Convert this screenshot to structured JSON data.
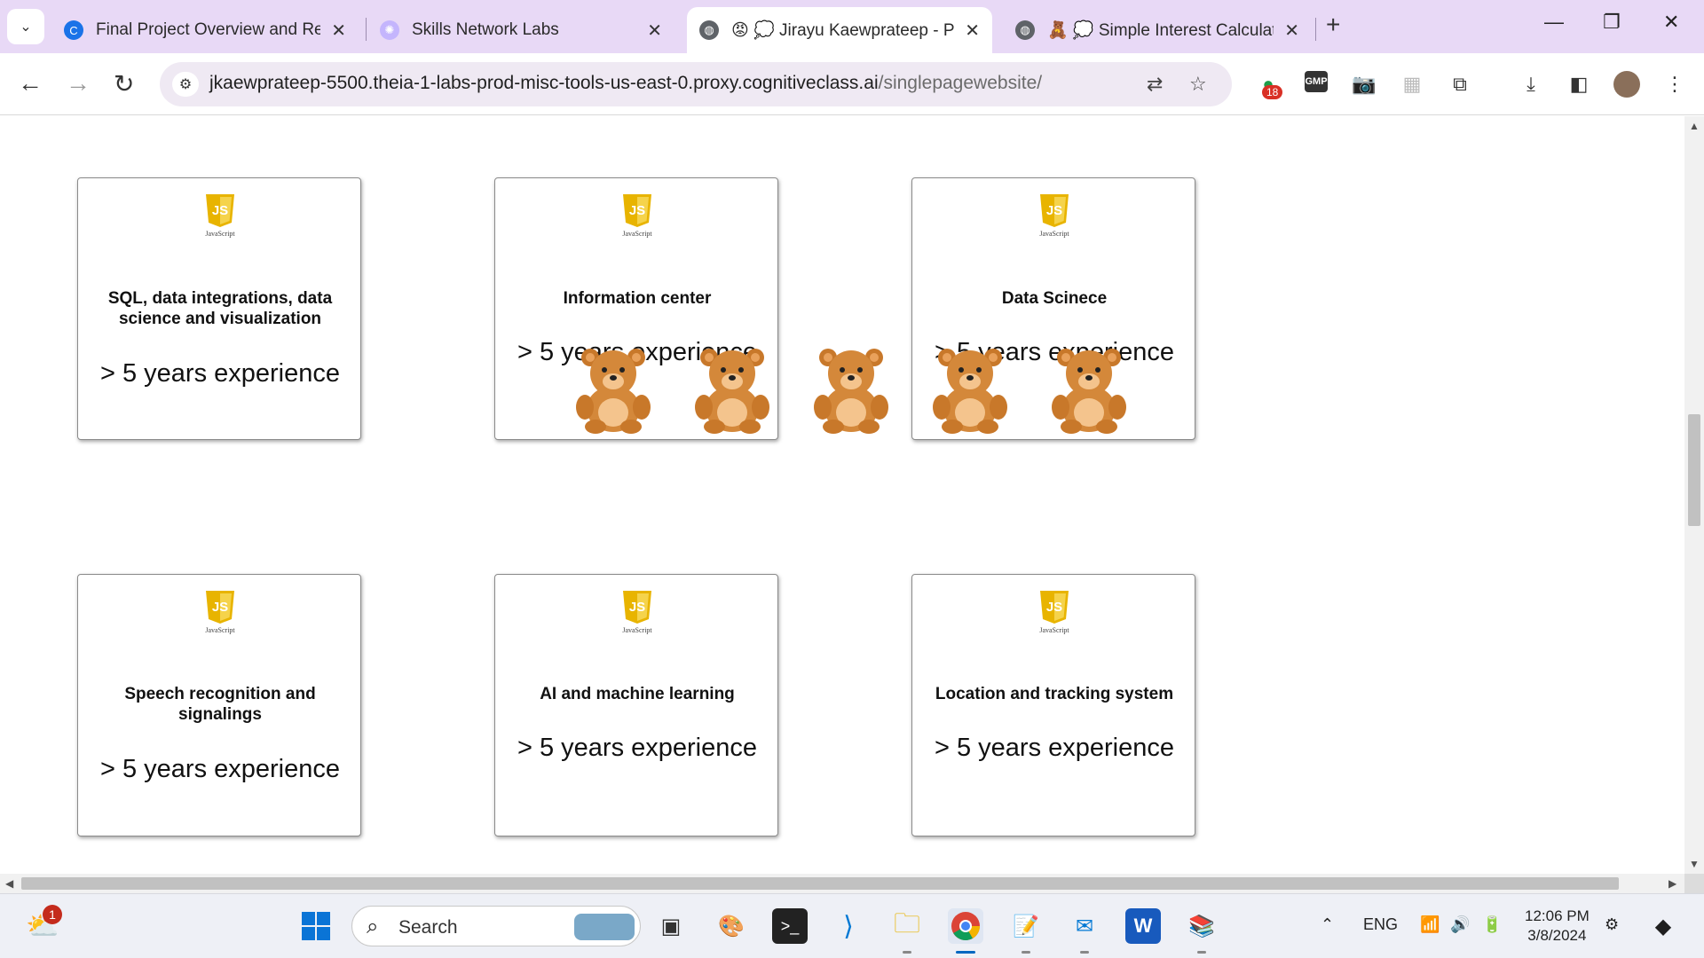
{
  "browser": {
    "tabs": [
      {
        "title": "Final Project Overview and Revi",
        "favicon": "coursera-icon",
        "color": "#1a73e8"
      },
      {
        "title": "Skills Network Labs",
        "favicon": "skills-network-icon",
        "color": "#a78bfa"
      },
      {
        "title": "😡 💭 Jirayu Kaewprateep - Por",
        "favicon": "globe-icon",
        "color": "#555555"
      },
      {
        "title": "🧸 💭 Simple Interest Calculato",
        "favicon": "globe-icon",
        "color": "#555555"
      }
    ],
    "new_tab_label": "+",
    "url_host": "jkaewprateep-5500.theia-1-labs-prod-misc-tools-us-east-0.proxy.cognitiveclass.ai",
    "url_path": "/singlepagewebsite/",
    "extension_badge": "18"
  },
  "page": {
    "cards": [
      {
        "logo_sub": "JavaScript",
        "title": "SQL, data integrations, data science and visualization",
        "experience": "> 5 years experience"
      },
      {
        "logo_sub": "JavaScript",
        "title": "Information center",
        "experience": "> 5 years experience"
      },
      {
        "logo_sub": "JavaScript",
        "title": "Data Scinece",
        "experience": "> 5 years experience"
      },
      {
        "logo_sub": "JavaScript",
        "title": "Speech recognition and signalings",
        "experience": "> 5 years experience"
      },
      {
        "logo_sub": "JavaScript",
        "title": "AI and machine learning",
        "experience": "> 5 years experience"
      },
      {
        "logo_sub": "JavaScript",
        "title": "Location and tracking system",
        "experience": "> 5 years experience"
      }
    ],
    "fab_color": "#7200c4",
    "teddy_bear_count": 5
  },
  "taskbar": {
    "search_placeholder": "Search",
    "weather_badge": "1",
    "language": "ENG",
    "time": "12:06 PM",
    "date": "3/8/2024"
  }
}
